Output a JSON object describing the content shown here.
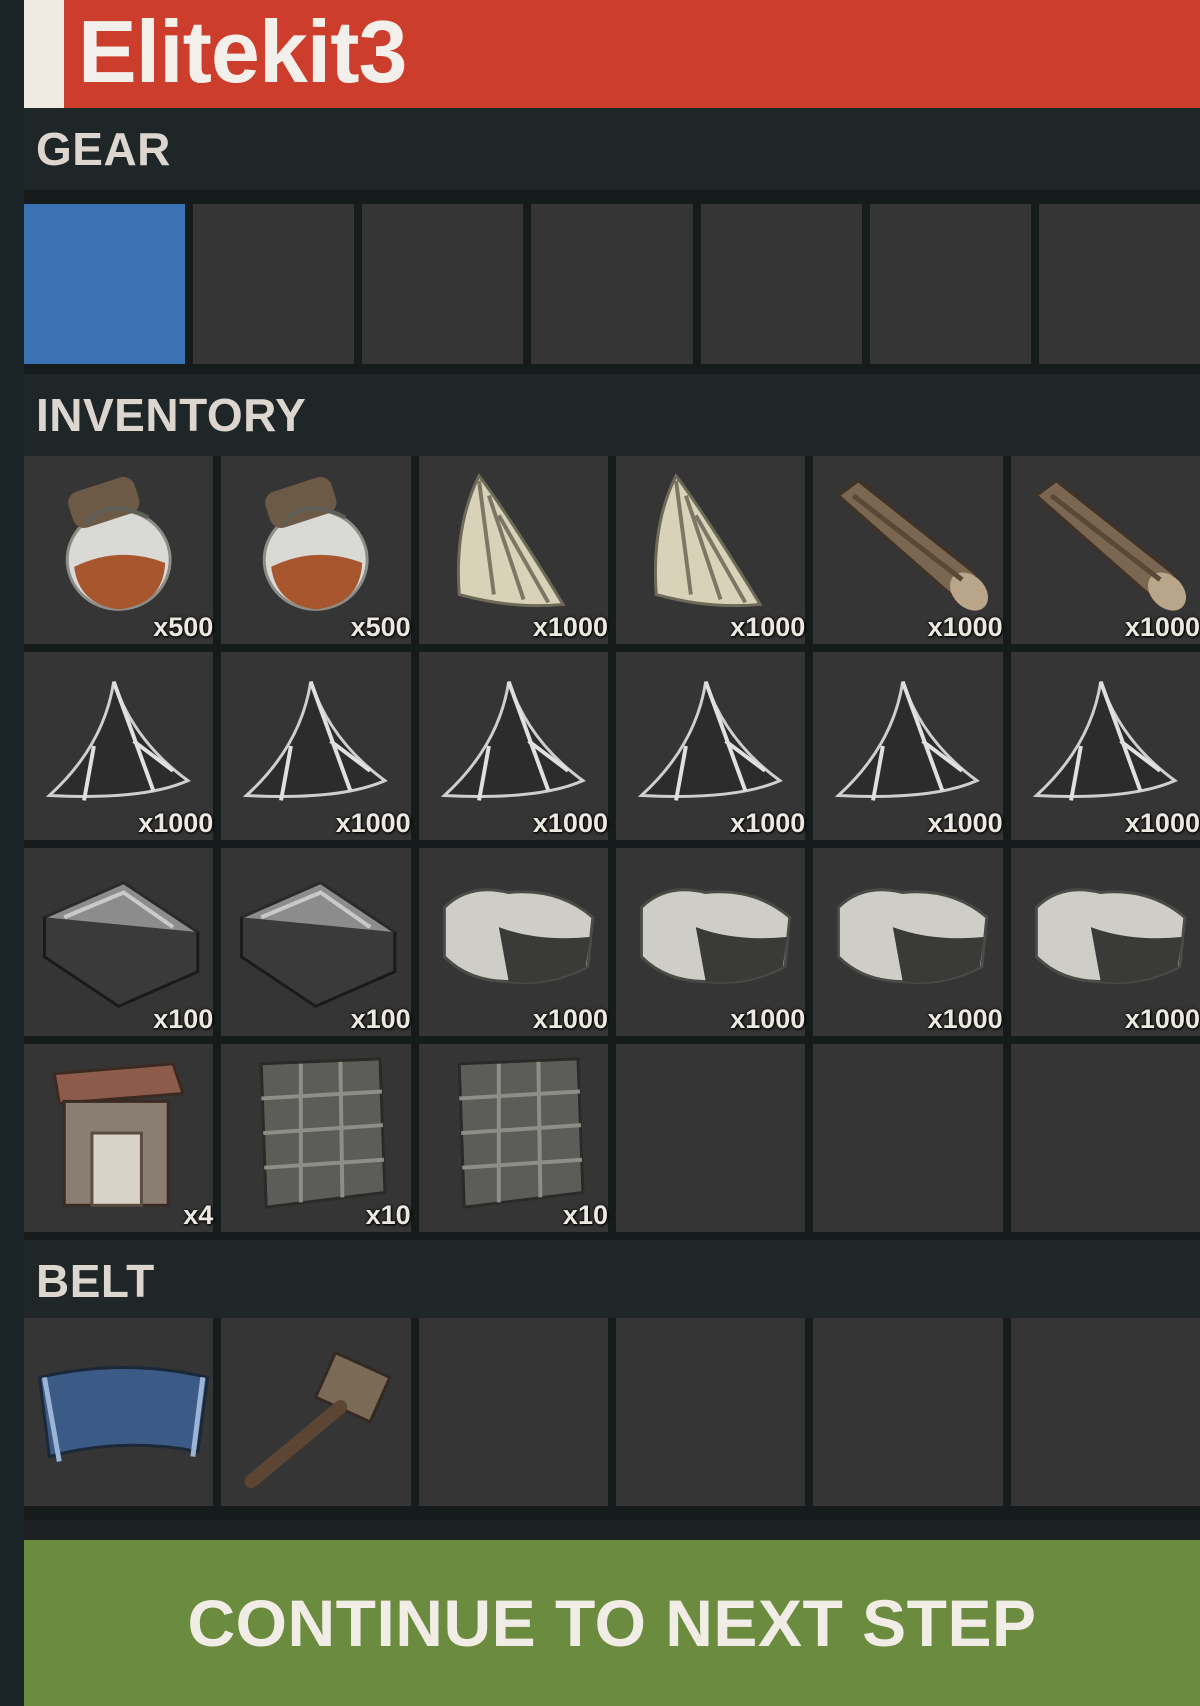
{
  "kit": {
    "title": "Elitekit3"
  },
  "sections": {
    "gear": {
      "label": "GEAR"
    },
    "inventory": {
      "label": "INVENTORY"
    },
    "belt": {
      "label": "BELT"
    }
  },
  "inventory": {
    "items": [
      {
        "icon": "jar-icon",
        "qty": "x500"
      },
      {
        "icon": "jar-icon",
        "qty": "x500"
      },
      {
        "icon": "cloth-icon",
        "qty": "x1000"
      },
      {
        "icon": "cloth-icon",
        "qty": "x1000"
      },
      {
        "icon": "wood-log-icon",
        "qty": "x1000"
      },
      {
        "icon": "wood-log-icon",
        "qty": "x1000"
      },
      {
        "icon": "metal-fragments-icon",
        "qty": "x1000"
      },
      {
        "icon": "metal-fragments-icon",
        "qty": "x1000"
      },
      {
        "icon": "metal-fragments-icon",
        "qty": "x1000"
      },
      {
        "icon": "metal-fragments-icon",
        "qty": "x1000"
      },
      {
        "icon": "metal-fragments-icon",
        "qty": "x1000"
      },
      {
        "icon": "metal-fragments-icon",
        "qty": "x1000"
      },
      {
        "icon": "metal-ingot-icon",
        "qty": "x100"
      },
      {
        "icon": "metal-ingot-icon",
        "qty": "x100"
      },
      {
        "icon": "stone-icon",
        "qty": "x1000"
      },
      {
        "icon": "stone-icon",
        "qty": "x1000"
      },
      {
        "icon": "stone-icon",
        "qty": "x1000"
      },
      {
        "icon": "stone-icon",
        "qty": "x1000"
      },
      {
        "icon": "furnace-icon",
        "qty": "x4"
      },
      {
        "icon": "stone-wall-icon",
        "qty": "x10"
      },
      {
        "icon": "stone-wall-icon",
        "qty": "x10"
      }
    ]
  },
  "belt": {
    "items": [
      {
        "icon": "building-plan-icon",
        "qty": ""
      },
      {
        "icon": "hammer-icon",
        "qty": ""
      }
    ]
  },
  "colors": {
    "title_bar": "#cd3d2c",
    "selected_slot": "#3a72b3",
    "continue_button": "#6b8c3e"
  },
  "continue": {
    "label": "CONTINUE TO NEXT STEP"
  }
}
